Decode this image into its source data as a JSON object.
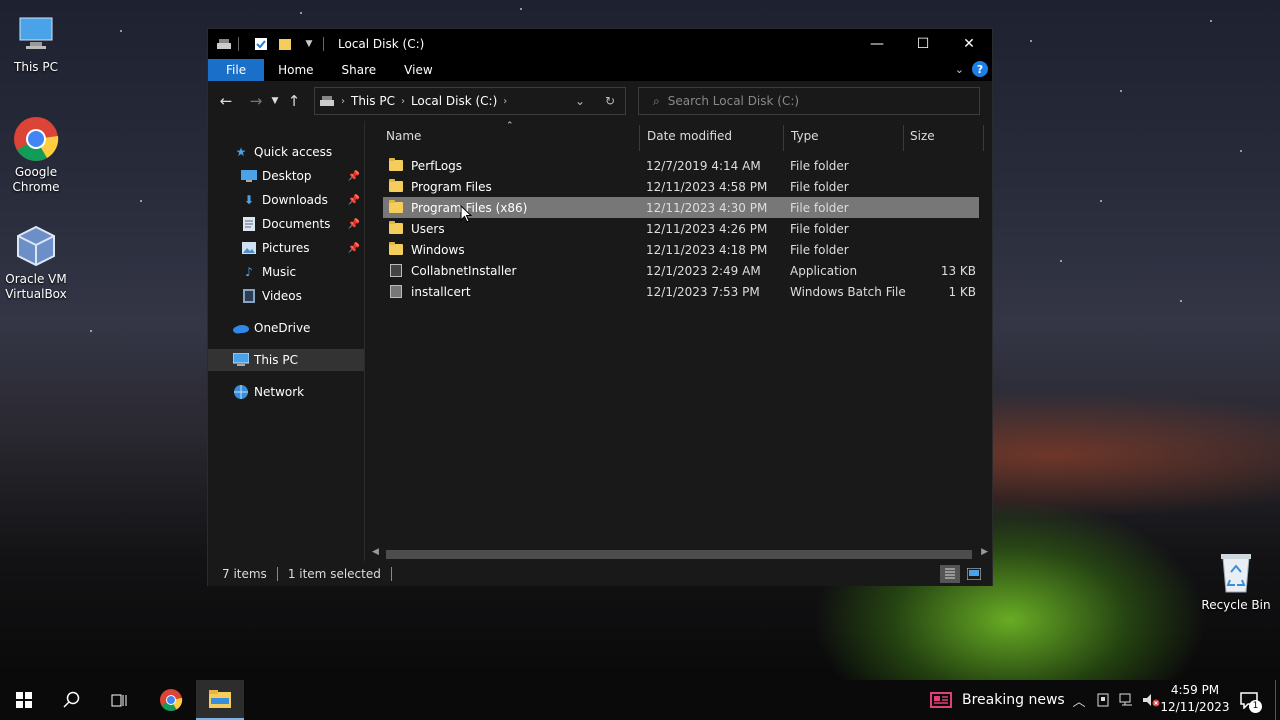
{
  "desktop": {
    "icons": [
      {
        "label": "This PC"
      },
      {
        "label": "Google Chrome"
      },
      {
        "label": "Oracle VM VirtualBox"
      },
      {
        "label": "Recycle Bin"
      }
    ]
  },
  "window": {
    "title": "Local Disk (C:)",
    "ribbon_tabs": [
      "File",
      "Home",
      "Share",
      "View"
    ],
    "help_label": "?",
    "address": {
      "crumbs": [
        "This PC",
        "Local Disk (C:)"
      ]
    },
    "search": {
      "placeholder": "Search Local Disk (C:)"
    },
    "nav_pane": [
      {
        "label": "Quick access",
        "icon": "star-icon",
        "pinned": false
      },
      {
        "label": "Desktop",
        "icon": "desktop-folder-icon",
        "pinned": true
      },
      {
        "label": "Downloads",
        "icon": "downloads-folder-icon",
        "pinned": true
      },
      {
        "label": "Documents",
        "icon": "documents-folder-icon",
        "pinned": true
      },
      {
        "label": "Pictures",
        "icon": "pictures-folder-icon",
        "pinned": true
      },
      {
        "label": "Music",
        "icon": "music-folder-icon",
        "pinned": false
      },
      {
        "label": "Videos",
        "icon": "videos-folder-icon",
        "pinned": false
      },
      {
        "label": "OneDrive",
        "icon": "onedrive-icon",
        "pinned": false
      },
      {
        "label": "This PC",
        "icon": "this-pc-icon",
        "pinned": false,
        "selected": true
      },
      {
        "label": "Network",
        "icon": "network-icon",
        "pinned": false
      }
    ],
    "columns": [
      "Name",
      "Date modified",
      "Type",
      "Size"
    ],
    "files": [
      {
        "name": "PerfLogs",
        "date": "12/7/2019 4:14 AM",
        "type": "File folder",
        "size": "",
        "icon": "folder-icon"
      },
      {
        "name": "Program Files",
        "date": "12/11/2023 4:58 PM",
        "type": "File folder",
        "size": "",
        "icon": "folder-icon"
      },
      {
        "name": "Program Files (x86)",
        "date": "12/11/2023 4:30 PM",
        "type": "File folder",
        "size": "",
        "icon": "folder-icon",
        "selected": true
      },
      {
        "name": "Users",
        "date": "12/11/2023 4:26 PM",
        "type": "File folder",
        "size": "",
        "icon": "folder-icon"
      },
      {
        "name": "Windows",
        "date": "12/11/2023 4:18 PM",
        "type": "File folder",
        "size": "",
        "icon": "folder-icon"
      },
      {
        "name": "CollabnetInstaller",
        "date": "12/1/2023 2:49 AM",
        "type": "Application",
        "size": "13 KB",
        "icon": "application-icon"
      },
      {
        "name": "installcert",
        "date": "12/1/2023 7:53 PM",
        "type": "Windows Batch File",
        "size": "1 KB",
        "icon": "batch-file-icon"
      }
    ],
    "status": {
      "items": "7 items",
      "selected": "1 item selected"
    }
  },
  "taskbar": {
    "news": "Breaking news",
    "time": "4:59 PM",
    "date": "12/11/2023",
    "notification_count": "1"
  },
  "colors": {
    "accent": "#1a6fc9",
    "folder": "#f4cd5c",
    "selection": "#777777"
  }
}
